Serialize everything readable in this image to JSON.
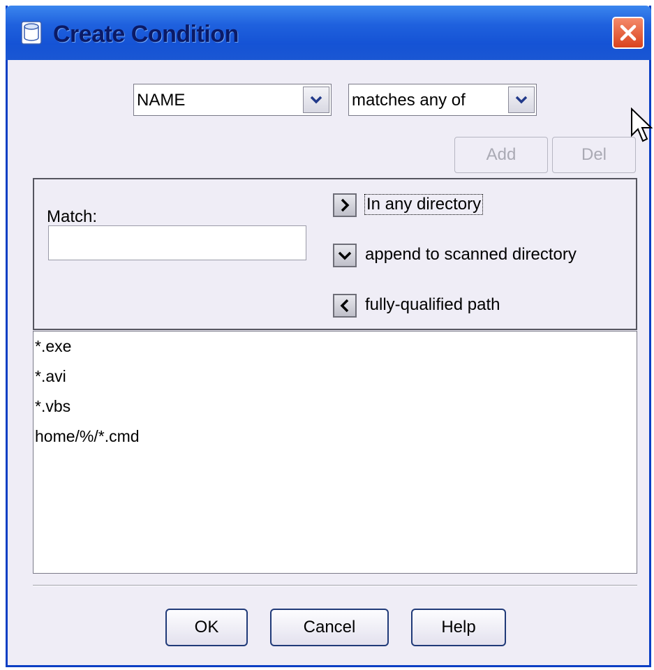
{
  "window": {
    "title": "Create Condition"
  },
  "condition": {
    "field_value": "NAME",
    "operator_value": "matches any of"
  },
  "pattern_buttons": {
    "add_label": "Add",
    "del_label": "Del"
  },
  "match": {
    "label": "Match:",
    "input_value": "",
    "options": [
      {
        "label": "In any directory",
        "icon": "chevron-right-icon"
      },
      {
        "label": "append to scanned directory",
        "icon": "chevron-down-icon"
      },
      {
        "label": "fully-qualified path",
        "icon": "chevron-left-icon"
      }
    ]
  },
  "patterns": [
    "*.exe",
    "*.avi",
    "*.vbs",
    "home/%/*.cmd"
  ],
  "footer": {
    "ok_label": "OK",
    "cancel_label": "Cancel",
    "help_label": "Help"
  },
  "colors": {
    "title_bar": "#1f61de",
    "close_button": "#d9431e",
    "dialog_background": "#efedf6"
  }
}
